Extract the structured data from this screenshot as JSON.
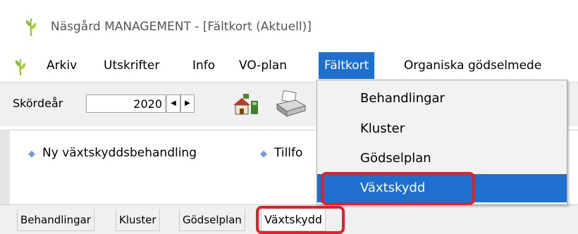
{
  "window": {
    "title": "Näsgård MANAGEMENT - [Fältkort (Aktuell)]",
    "icon": "wheat-leaf-icon"
  },
  "menubar": {
    "items": [
      "Arkiv",
      "Utskrifter",
      "Info",
      "VO-plan",
      "Fältkort",
      "Organiska gödselmede"
    ],
    "active": "Fältkort"
  },
  "toolbar": {
    "year_label": "Skördeår",
    "year_value": "2020",
    "icons": [
      "farm-house-icon",
      "printer-icon"
    ]
  },
  "tasks": {
    "items": [
      "Ny växtskyddsbehandling",
      "Tillfo"
    ]
  },
  "tabs": {
    "items": [
      "Behandlingar",
      "Kluster",
      "Gödselplan",
      "Växtskydd"
    ],
    "selected": "Växtskydd"
  },
  "dropdown": {
    "items": [
      "Behandlingar",
      "Kluster",
      "Gödselplan",
      "Växtskydd"
    ],
    "highlighted": "Växtskydd"
  },
  "colors": {
    "accent": "#1e6fce",
    "highlight_outline": "#e0202a",
    "toolbar_bg": "#f0f0f0"
  }
}
